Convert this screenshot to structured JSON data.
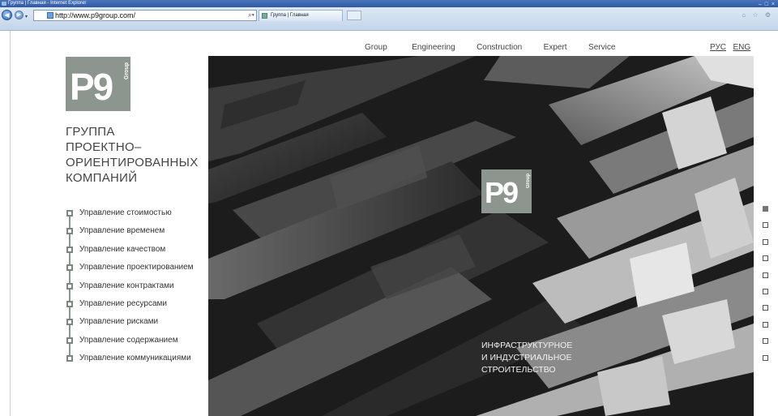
{
  "browser": {
    "title": "Группа | Главная - Internet Explorer",
    "url": "http://www.p9group.com/",
    "tab_title": "Группа | Главная"
  },
  "nav": {
    "items": [
      {
        "label": "Group"
      },
      {
        "label": "Engineering"
      },
      {
        "label": "Construction"
      },
      {
        "label": "Expert"
      },
      {
        "label": "Service"
      }
    ],
    "languages": [
      {
        "label": "РУС"
      },
      {
        "label": "ENG"
      }
    ]
  },
  "brand": {
    "logo_text": "P9",
    "logo_sub": "Group",
    "logo_color": "#8d968e"
  },
  "tagline": [
    "ГРУППА",
    "ПРОЕКТНО–",
    "ОРИЕНТИРОВАННЫХ",
    "КОМПАНИЙ"
  ],
  "services": [
    {
      "label": "Управление стоимостью"
    },
    {
      "label": "Управление временем"
    },
    {
      "label": "Управление качеством"
    },
    {
      "label": "Управление проектированием"
    },
    {
      "label": "Управление контрактами"
    },
    {
      "label": "Управление ресурсами"
    },
    {
      "label": "Управление рисками"
    },
    {
      "label": "Управление содержанием"
    },
    {
      "label": "Управление коммуникациями"
    }
  ],
  "hero": {
    "logo_text": "P9",
    "logo_sub": "Group",
    "caption": [
      "ИНФРАСТРУКТУРНОЕ",
      "И ИНДУСТРИАЛЬНОЕ",
      "СТРОИТЕЛЬСТВО"
    ]
  },
  "slides": {
    "count": 10,
    "active_index": 0
  }
}
